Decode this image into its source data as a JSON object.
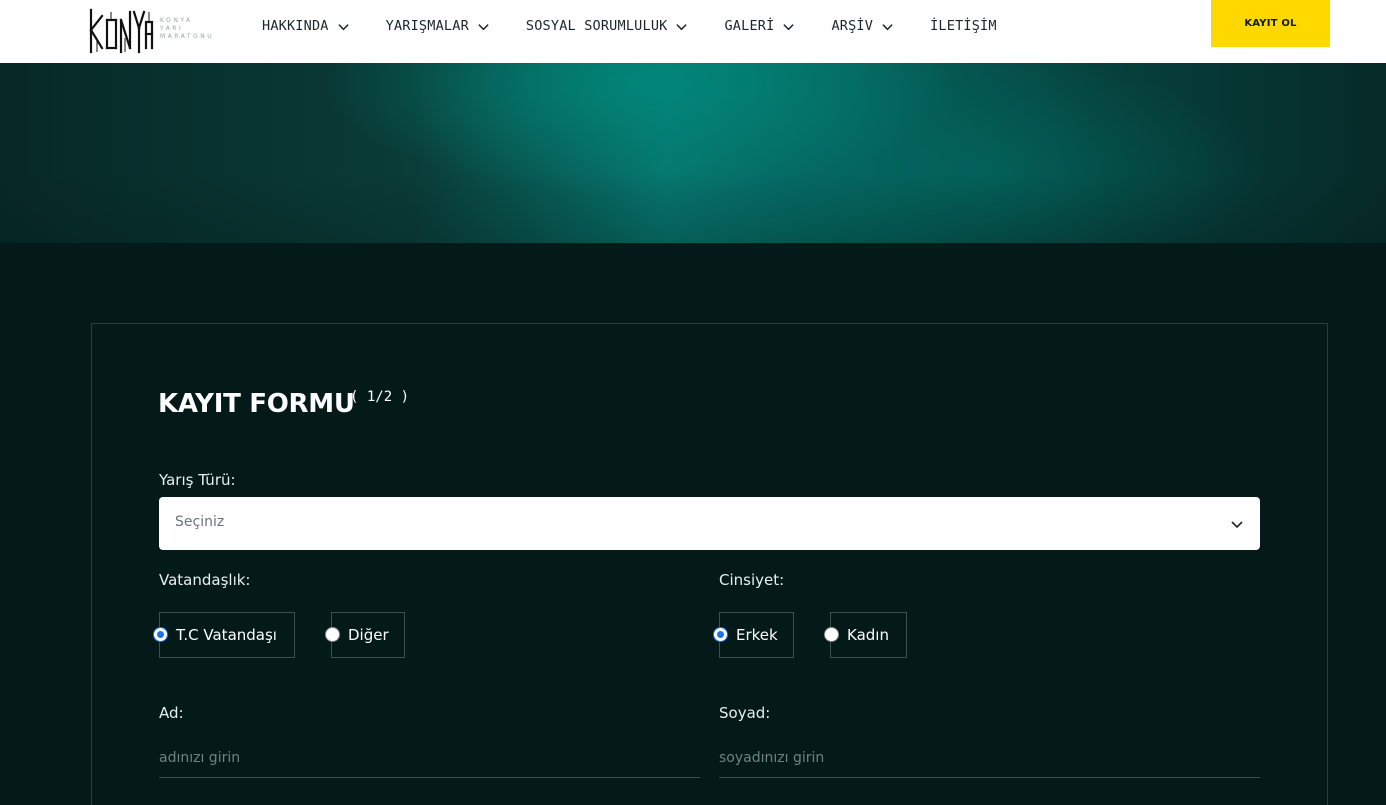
{
  "header": {
    "logo_wordmark": "KONYA",
    "logo_subtitle": [
      "KONYA",
      "YARI",
      "MARATONU"
    ],
    "nav": [
      {
        "label": "HAKKINDA",
        "dropdown": true
      },
      {
        "label": "YARIŞMALAR",
        "dropdown": true
      },
      {
        "label": "SOSYAL SORUMLULUK",
        "dropdown": true
      },
      {
        "label": "GALERİ",
        "dropdown": true
      },
      {
        "label": "ARŞİV",
        "dropdown": true
      },
      {
        "label": "İLETİŞİM",
        "dropdown": false
      }
    ],
    "cta_label": "KAYIT OL"
  },
  "colors": {
    "accent": "#ffd800",
    "page_bg": "#031a19",
    "radio_checked": "#1a73e8"
  },
  "form": {
    "title": "KAYIT FORMU",
    "step": "( 1/2 )",
    "race_type": {
      "label": "Yarış Türü:",
      "value": "Seçiniz"
    },
    "citizenship": {
      "label": "Vatandaşlık:",
      "options": [
        {
          "label": "T.C Vatandaşı",
          "checked": true
        },
        {
          "label": "Diğer",
          "checked": false
        }
      ]
    },
    "gender": {
      "label": "Cinsiyet:",
      "options": [
        {
          "label": "Erkek",
          "checked": true
        },
        {
          "label": "Kadın",
          "checked": false
        }
      ]
    },
    "first_name": {
      "label": "Ad:",
      "placeholder": "adınızı girin",
      "value": ""
    },
    "last_name": {
      "label": "Soyad:",
      "placeholder": "soyadınızı girin",
      "value": ""
    }
  }
}
